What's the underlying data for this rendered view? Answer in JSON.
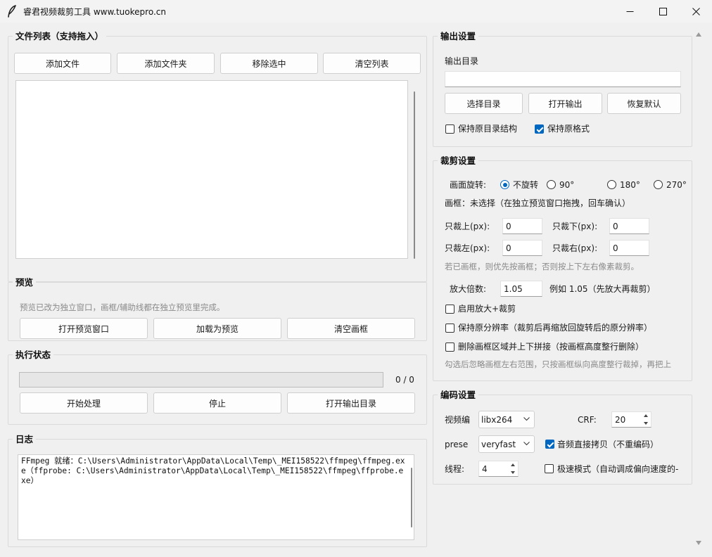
{
  "window": {
    "title": "睿君视频裁剪工具  www.tuokepro.cn",
    "icon": "feather-icon",
    "controls": [
      "minimize-icon",
      "maximize-icon",
      "close-icon"
    ]
  },
  "file_list": {
    "title": "文件列表（支持拖入）",
    "add_file": "添加文件",
    "add_folder": "添加文件夹",
    "remove_selected": "移除选中",
    "clear_list": "清空列表",
    "items": []
  },
  "preview": {
    "title": "预览",
    "hint": "预览已改为独立窗口，画框/辅助线都在独立预览里完成。",
    "open_window": "打开预览窗口",
    "load_preview": "加载为预览",
    "clear_frame": "清空画框"
  },
  "status": {
    "title": "执行状态",
    "progress": 0,
    "count_text": "0 / 0",
    "start": "开始处理",
    "stop": "停止",
    "open_output_dir": "打开输出目录"
  },
  "log": {
    "title": "日志",
    "text": "FFmpeg 就绪：C:\\Users\\Administrator\\AppData\\Local\\Temp\\_MEI158522\\ffmpeg\\ffmpeg.exe（ffprobe: C:\\Users\\Administrator\\AppData\\Local\\Temp\\_MEI158522\\ffmpeg\\ffprobe.exe）"
  },
  "output": {
    "title": "输出设置",
    "dir_label": "输出目录",
    "dir_value": "",
    "choose_dir": "选择目录",
    "open_output": "打开输出",
    "restore_default": "恢复默认",
    "keep_structure": {
      "label": "保持原目录结构",
      "checked": false
    },
    "keep_format": {
      "label": "保持原格式",
      "checked": true
    }
  },
  "crop": {
    "title": "裁剪设置",
    "rotate_label": "画面旋转:",
    "rotate_options": [
      {
        "label": "不旋转",
        "selected": true
      },
      {
        "label": "90°",
        "selected": false
      },
      {
        "label": "180°",
        "selected": false
      },
      {
        "label": "270°",
        "selected": false
      }
    ],
    "frame_text": "画框：未选择（在独立预览窗口拖拽，回车确认）",
    "top_label": "只裁上(px):",
    "top_value": "0",
    "bottom_label": "只裁下(px):",
    "bottom_value": "0",
    "left_label": "只裁左(px):",
    "left_value": "0",
    "right_label": "只裁右(px):",
    "right_value": "0",
    "px_hint": "若已画框，则优先按画框；否则按上下左右像素裁剪。",
    "zoom_label": "放大倍数:",
    "zoom_value": "1.05",
    "zoom_hint": "例如 1.05（先放大再裁剪）",
    "enable_zoom": {
      "label": "启用放大+裁剪",
      "checked": false
    },
    "keep_resolution": {
      "label": "保持原分辨率（裁剪后再缩放回旋转后的原分辨率）",
      "checked": false
    },
    "delete_splice": {
      "label": "删除画框区域并上下拼接（按画框高度整行删除）",
      "checked": false
    },
    "splice_hint": "勾选后忽略画框左右范围，只按画框纵向高度整行裁掉，再把上"
  },
  "encode": {
    "title": "编码设置",
    "codec_label": "视频编",
    "codec_value": "libx264",
    "crf_label": "CRF:",
    "crf_value": "20",
    "preset_label": "prese",
    "preset_value": "veryfast",
    "audio_copy": {
      "label": "音频直接拷贝（不重编码）",
      "checked": true
    },
    "threads_label": "线程:",
    "threads_value": "4",
    "fast_mode": {
      "label": "极速模式（自动调成偏向速度的-",
      "checked": false
    }
  },
  "colors": {
    "accent": "#0067c0",
    "background": "#f0f0f0",
    "border": "#dadada",
    "hint_text": "#8a8a8a"
  }
}
